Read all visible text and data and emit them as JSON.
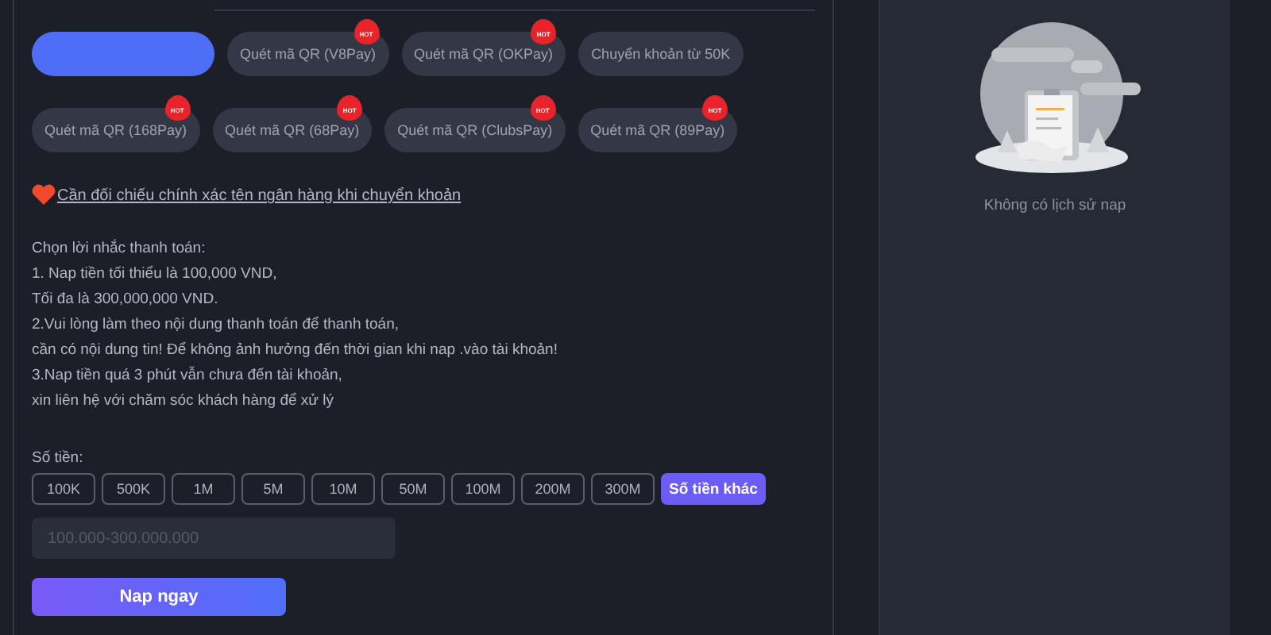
{
  "methods": [
    {
      "selected": true
    },
    {
      "label": "Quét mã QR (V8Pay)",
      "selected": false,
      "badge": "HOT"
    },
    {
      "label": "Quét mã QR (OKPay)",
      "selected": false,
      "badge": "HOT"
    },
    {
      "label": "Chuyển khoản từ 50K",
      "selected": false
    },
    {
      "label": "Quét mã QR (168Pay)",
      "selected": false,
      "badge": "HOT"
    },
    {
      "label": "Quét mã QR (68Pay)",
      "selected": false,
      "badge": "HOT"
    },
    {
      "label": "Quét mã QR (ClubsPay)",
      "selected": false,
      "badge": "HOT"
    },
    {
      "label": "Quét mã QR (89Pay)",
      "selected": false,
      "badge": "HOT"
    }
  ],
  "notice_link": "Cần đối chiếu chính xác tên ngân hàng khi chuyển khoản",
  "reminder_lines": [
    "Chọn lời nhắc thanh toán:",
    "1. Nap tiền tối thiểu là 100,000 VND,",
    "Tối đa là 300,000,000 VND.",
    "2.Vui lòng làm theo nội dung thanh toán để thanh toán,",
    "cần có nội dung tin! Để không ảnh hưởng đến thời gian khi nap .vào tài khoản!",
    "3.Nap tiền quá 3 phút vẫn chưa đến tài khoản,",
    "xin liên hệ với chăm sóc khách hàng để xử lý"
  ],
  "amount_label": "Số tiền:",
  "amounts": [
    {
      "label": "100K",
      "selected": false
    },
    {
      "label": "500K",
      "selected": false
    },
    {
      "label": "1M",
      "selected": false
    },
    {
      "label": "5M",
      "selected": false
    },
    {
      "label": "10M",
      "selected": false
    },
    {
      "label": "50M",
      "selected": false
    },
    {
      "label": "100M",
      "selected": false
    },
    {
      "label": "200M",
      "selected": false
    },
    {
      "label": "300M",
      "selected": false
    },
    {
      "label": "Số tiền khác",
      "selected": true
    }
  ],
  "amount_input": {
    "placeholder": "100.000-300.000.000"
  },
  "submit_button": "Nap ngay",
  "history": {
    "empty_text": "Không có lịch sử nap"
  }
}
